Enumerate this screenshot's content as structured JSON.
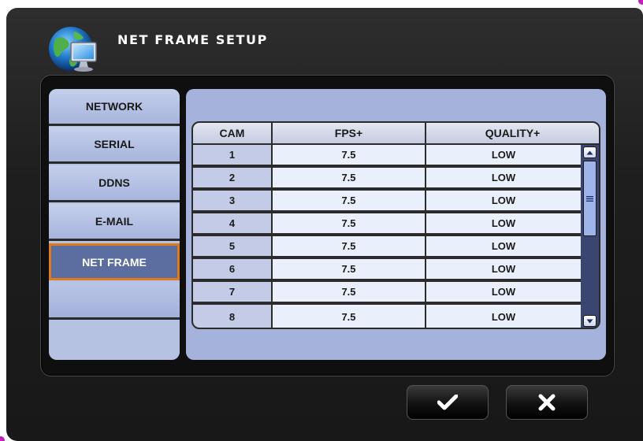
{
  "window": {
    "title": "NET FRAME SETUP"
  },
  "sidebar": {
    "tabs": [
      {
        "label": "NETWORK",
        "active": false
      },
      {
        "label": "SERIAL",
        "active": false
      },
      {
        "label": "DDNS",
        "active": false
      },
      {
        "label": "E-MAIL",
        "active": false
      },
      {
        "label": "NET FRAME",
        "active": true
      }
    ]
  },
  "table": {
    "columns": [
      "CAM",
      "FPS+",
      "QUALITY+"
    ],
    "rows": [
      {
        "cam": "1",
        "fps": "7.5",
        "quality": "LOW"
      },
      {
        "cam": "2",
        "fps": "7.5",
        "quality": "LOW"
      },
      {
        "cam": "3",
        "fps": "7.5",
        "quality": "LOW"
      },
      {
        "cam": "4",
        "fps": "7.5",
        "quality": "LOW"
      },
      {
        "cam": "5",
        "fps": "7.5",
        "quality": "LOW"
      },
      {
        "cam": "6",
        "fps": "7.5",
        "quality": "LOW"
      },
      {
        "cam": "7",
        "fps": "7.5",
        "quality": "LOW"
      },
      {
        "cam": "8",
        "fps": "7.5",
        "quality": "LOW"
      }
    ]
  },
  "buttons": {
    "ok_icon": "checkmark-icon",
    "cancel_icon": "x-icon"
  },
  "colors": {
    "active_tab_border": "#e07a1e",
    "active_tab_fill": "#5c6d9f",
    "panel_fill": "#a5b3dc"
  }
}
